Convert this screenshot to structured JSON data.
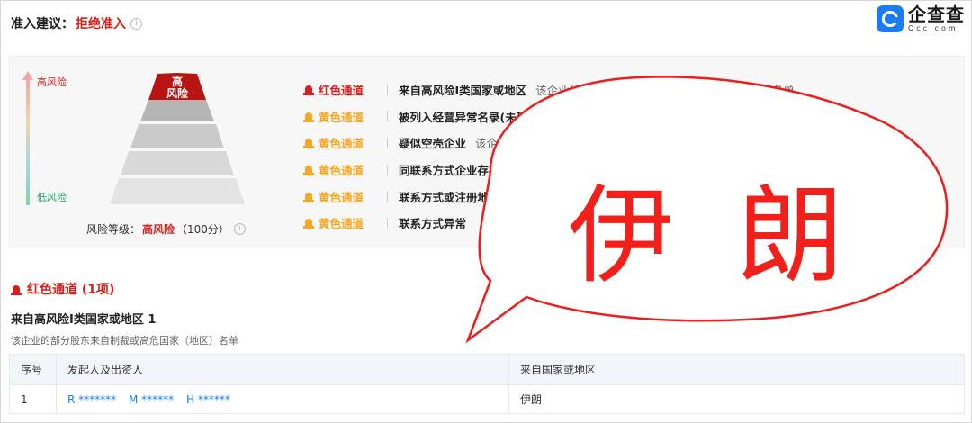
{
  "advice": {
    "label": "准入建议：",
    "value": "拒绝准入",
    "info": "i"
  },
  "logo": {
    "cn": "企查查",
    "en": "Qcc.com"
  },
  "scale": {
    "high": "高风险",
    "low": "低风险"
  },
  "pyramid": {
    "top_label_1": "高",
    "top_label_2": "风险",
    "active_level": "高风险"
  },
  "risk": {
    "label": "风险等级：",
    "level": "高风险",
    "score": "（100分）",
    "info": "i"
  },
  "colors": {
    "red": "#d7201d",
    "yellow": "#f5a623",
    "link": "#1a7cf0",
    "bubble": "#f2201a"
  },
  "channels": [
    {
      "color": "red",
      "name": "红色通道",
      "title": "来自高风险I类国家或地区",
      "desc": "该企业的部分股东来自制裁或高危国家（地区）名单"
    },
    {
      "color": "yellow",
      "name": "黄色通道",
      "title": "被列入经营异常名录(未移出)",
      "desc": "该企业被列"
    },
    {
      "color": "yellow",
      "name": "黄色通道",
      "title": "疑似空壳企业",
      "desc": "该企业存在7"
    },
    {
      "color": "yellow",
      "name": "黄色通道",
      "title": "同联系方式企业存在",
      "desc": ""
    },
    {
      "color": "yellow",
      "name": "黄色通道",
      "title": "联系方式或注册地",
      "desc": ""
    },
    {
      "color": "yellow",
      "name": "黄色通道",
      "title": "联系方式异常",
      "desc": ""
    }
  ],
  "section": {
    "heading": "红色通道 (1项)",
    "sub_title": "来自高风险I类国家或地区 1",
    "sub_desc": "该企业的部分股东来自制裁或高危国家（地区）名单"
  },
  "table": {
    "headers": [
      "序号",
      "发起人及出资人",
      "来自国家或地区"
    ],
    "rows": [
      {
        "index": "1",
        "persons": [
          "R *******",
          "M ******",
          "H ******"
        ],
        "region": "伊朗"
      }
    ]
  },
  "bubble": {
    "text_1": "伊",
    "text_2": "朗"
  }
}
